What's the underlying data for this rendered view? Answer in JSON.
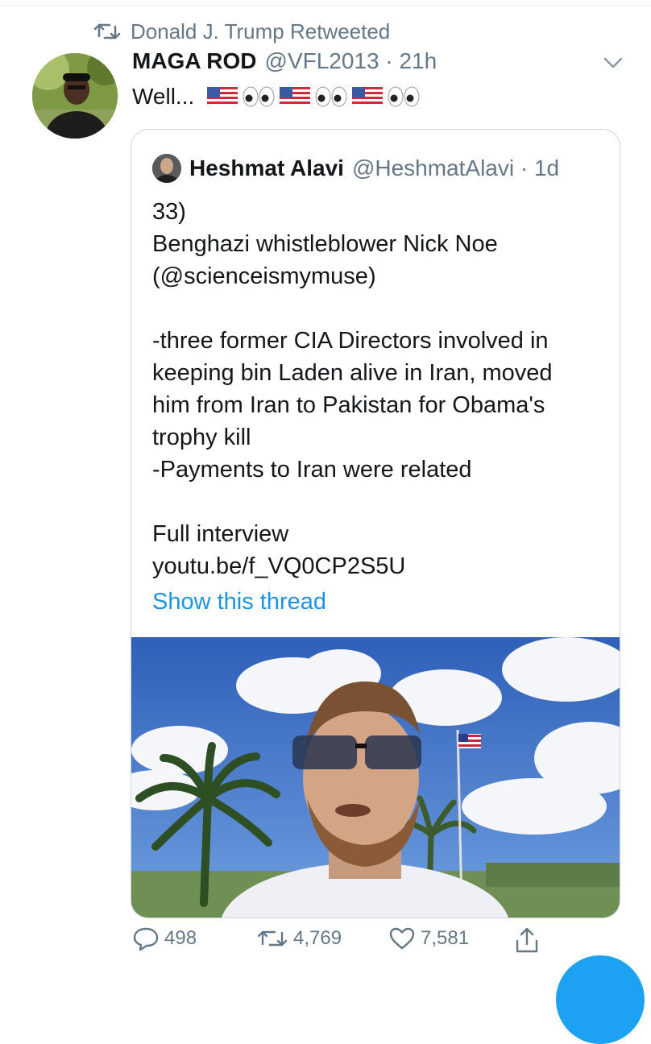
{
  "context": {
    "retweeted_by": "Donald J. Trump Retweeted",
    "icon": "retweet-icon"
  },
  "tweet": {
    "author_name": "MAGA ROD",
    "handle_time": "@VFL2013 · 21h",
    "text": "Well...",
    "emoji": [
      "us-flag",
      "eyes",
      "us-flag",
      "eyes",
      "us-flag",
      "eyes"
    ],
    "menu_icon": "chevron-down-icon"
  },
  "quote": {
    "author_name": "Heshmat Alavi",
    "handle_time": "@HeshmatAlavi · 1d",
    "lines": {
      "l1": "33)",
      "l2": "Benghazi whistleblower Nick Noe",
      "l3": "(@scienceismymuse)",
      "l4": "-three former CIA Directors involved in",
      "l5": "keeping bin Laden alive in Iran, moved",
      "l6": "him from Iran to Pakistan for Obama's",
      "l7": "trophy kill",
      "l8": "-Payments to Iran were related",
      "l9": "Full interview",
      "l10": "youtu.be/f_VQ0CP2S5U"
    },
    "show_thread": "Show this thread"
  },
  "actions": {
    "replies": "498",
    "retweets": "4,769",
    "likes": "7,581"
  },
  "colors": {
    "link": "#1b95e0",
    "muted": "#657786",
    "border": "#ccd6dd"
  }
}
